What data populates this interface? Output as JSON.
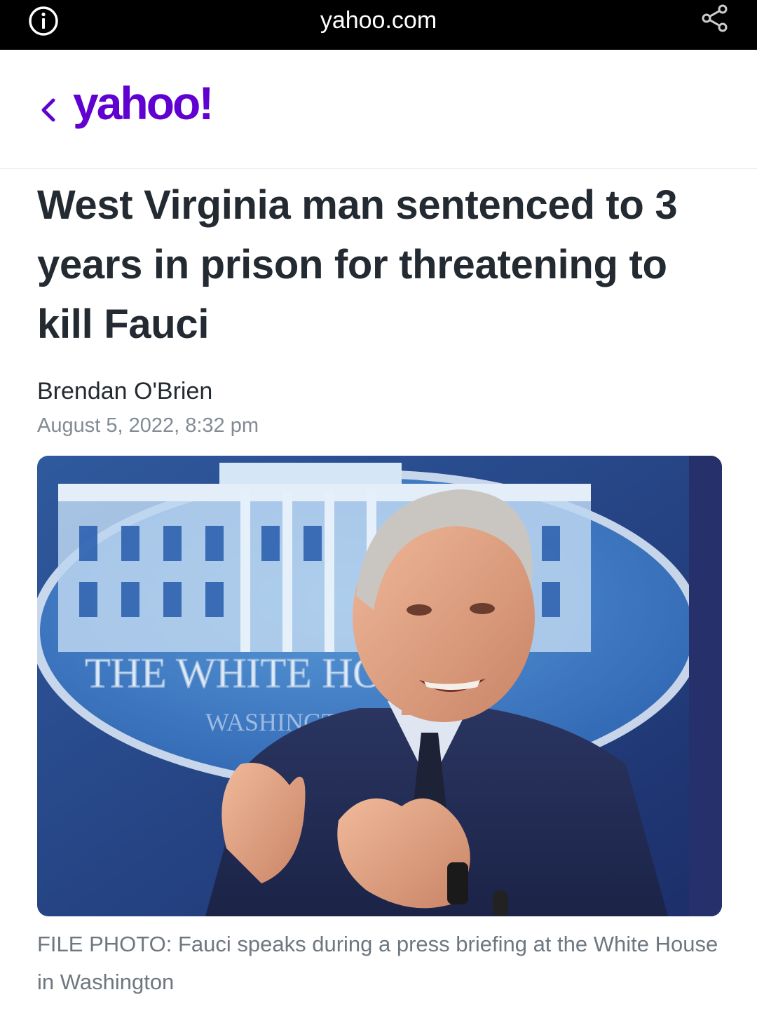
{
  "browser": {
    "url": "yahoo.com",
    "info_icon": "info-circle-icon",
    "share_icon": "share-icon"
  },
  "site": {
    "back_icon": "chevron-left-icon",
    "logo_text": "yahoo!",
    "brand_color": "#6001d2"
  },
  "article": {
    "headline": "West Virginia man sentenced to 3 years in prison for threatening to kill Fauci",
    "author": "Brendan O'Brien",
    "date": "August 5, 2022, 8:32 pm",
    "photo_sign_text": "THE WHITE HOUSE",
    "photo_sign_subtext": "WASHINGTON",
    "caption": "FILE PHOTO: Fauci speaks during a press briefing at the White House in Washington"
  }
}
